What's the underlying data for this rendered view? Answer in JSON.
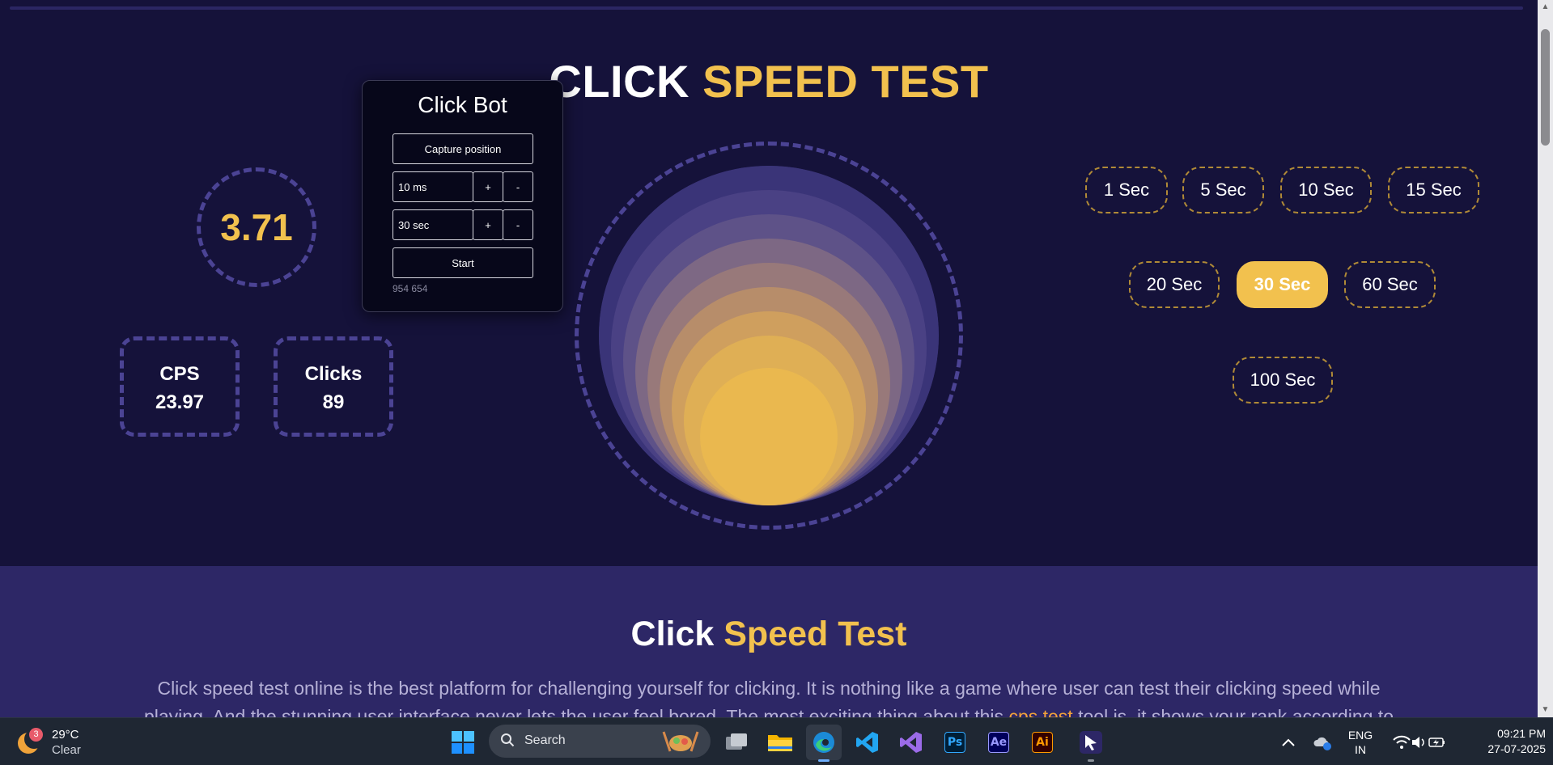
{
  "hero": {
    "title_part1": "CLICK",
    "title_part2": "SPEED TEST"
  },
  "stats": {
    "score": "3.71",
    "cps_label": "CPS",
    "cps_value": "23.97",
    "clicks_label": "Clicks",
    "clicks_value": "89"
  },
  "click_bot": {
    "title": "Click Bot",
    "capture_label": "Capture position",
    "interval_value": "10 ms",
    "duration_value": "30 sec",
    "plus_label": "+",
    "minus_label": "-",
    "start_label": "Start",
    "position_readout": "954 654"
  },
  "time_options": [
    "1 Sec",
    "5 Sec",
    "10 Sec",
    "15 Sec",
    "20 Sec",
    "30 Sec",
    "60 Sec",
    "100 Sec"
  ],
  "selected_time": "30 Sec",
  "section": {
    "heading_part1": "Click",
    "heading_part2": "Speed Test",
    "para_line1": "Click speed test online is the best platform for challenging yourself for clicking. It is nothing like a game where user can test their clicking speed while",
    "para_line2_a": "playing. And the stunning user interface never lets the user feel bored. The most exciting thing about this ",
    "para_link": "cps test",
    "para_line2_b": " tool is, it shows your rank according to"
  },
  "taskbar": {
    "weather_badge": "3",
    "temperature": "29°C",
    "condition": "Clear",
    "search_label": "Search",
    "language_line1": "ENG",
    "language_line2": "IN",
    "time": "09:21 PM",
    "date": "27-07-2025",
    "apps": [
      "start-icon",
      "task-view-icon",
      "file-explorer-icon",
      "edge-icon",
      "vscode-icon",
      "visual-studio-icon",
      "photoshop-icon",
      "after-effects-icon",
      "illustrator-icon",
      "cursor-app-icon"
    ]
  },
  "colors": {
    "background": "#15123a",
    "accent": "#f2c14e",
    "section_bg": "#2d2766",
    "dashed": "#4b4394",
    "link": "#f2a33a"
  }
}
